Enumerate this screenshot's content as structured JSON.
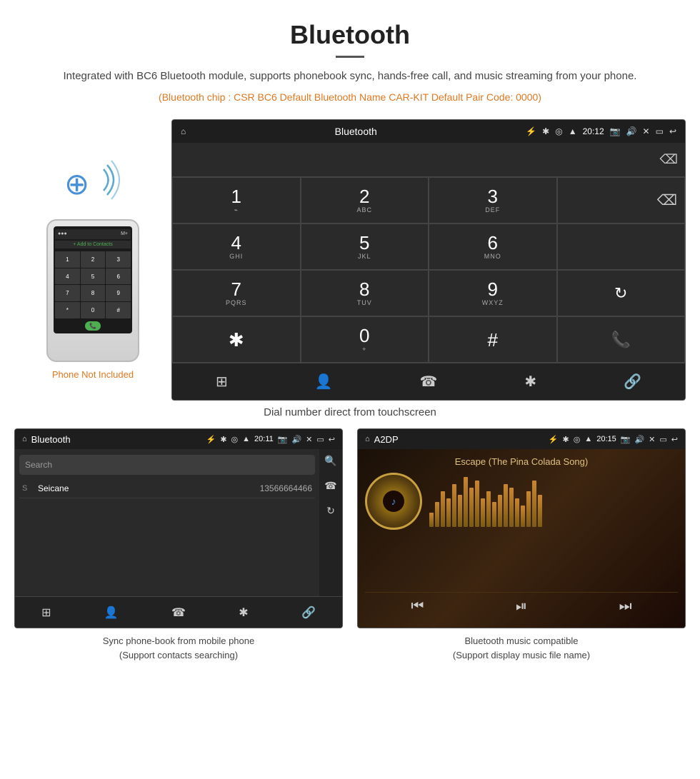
{
  "header": {
    "title": "Bluetooth",
    "description": "Integrated with BC6 Bluetooth module, supports phonebook sync, hands-free call, and music streaming from your phone.",
    "specs": "(Bluetooth chip : CSR BC6    Default Bluetooth Name CAR-KIT    Default Pair Code: 0000)"
  },
  "dialer": {
    "screen_title": "Bluetooth",
    "time": "20:12",
    "keys": [
      {
        "main": "1",
        "sub": "⌁"
      },
      {
        "main": "2",
        "sub": "ABC"
      },
      {
        "main": "3",
        "sub": "DEF"
      },
      {
        "main": "",
        "sub": ""
      },
      {
        "main": "4",
        "sub": "GHI"
      },
      {
        "main": "5",
        "sub": "JKL"
      },
      {
        "main": "6",
        "sub": "MNO"
      },
      {
        "main": "",
        "sub": ""
      },
      {
        "main": "7",
        "sub": "PQRS"
      },
      {
        "main": "8",
        "sub": "TUV"
      },
      {
        "main": "9",
        "sub": "WXYZ"
      },
      {
        "main": "↻",
        "sub": ""
      },
      {
        "main": "*",
        "sub": ""
      },
      {
        "main": "0",
        "sub": "+"
      },
      {
        "main": "#",
        "sub": ""
      },
      {
        "main": "",
        "sub": ""
      }
    ]
  },
  "dial_caption": "Dial number direct from touchscreen",
  "phone_not_included": "Phone Not Included",
  "phonebook": {
    "screen_title": "Bluetooth",
    "time": "20:11",
    "search_placeholder": "Search",
    "contacts": [
      {
        "letter": "S",
        "name": "Seicane",
        "number": "13566664466"
      }
    ]
  },
  "phonebook_caption": "Sync phone-book from mobile phone\n(Support contacts searching)",
  "music": {
    "screen_title": "A2DP",
    "time": "20:15",
    "song_title": "Escape (The Pina Colada Song)",
    "vis_heights": [
      20,
      35,
      50,
      40,
      60,
      45,
      70,
      55,
      65,
      40,
      50,
      35,
      45,
      60,
      55,
      40,
      30,
      50,
      65,
      45
    ]
  },
  "music_caption": "Bluetooth music compatible\n(Support display music file name)"
}
